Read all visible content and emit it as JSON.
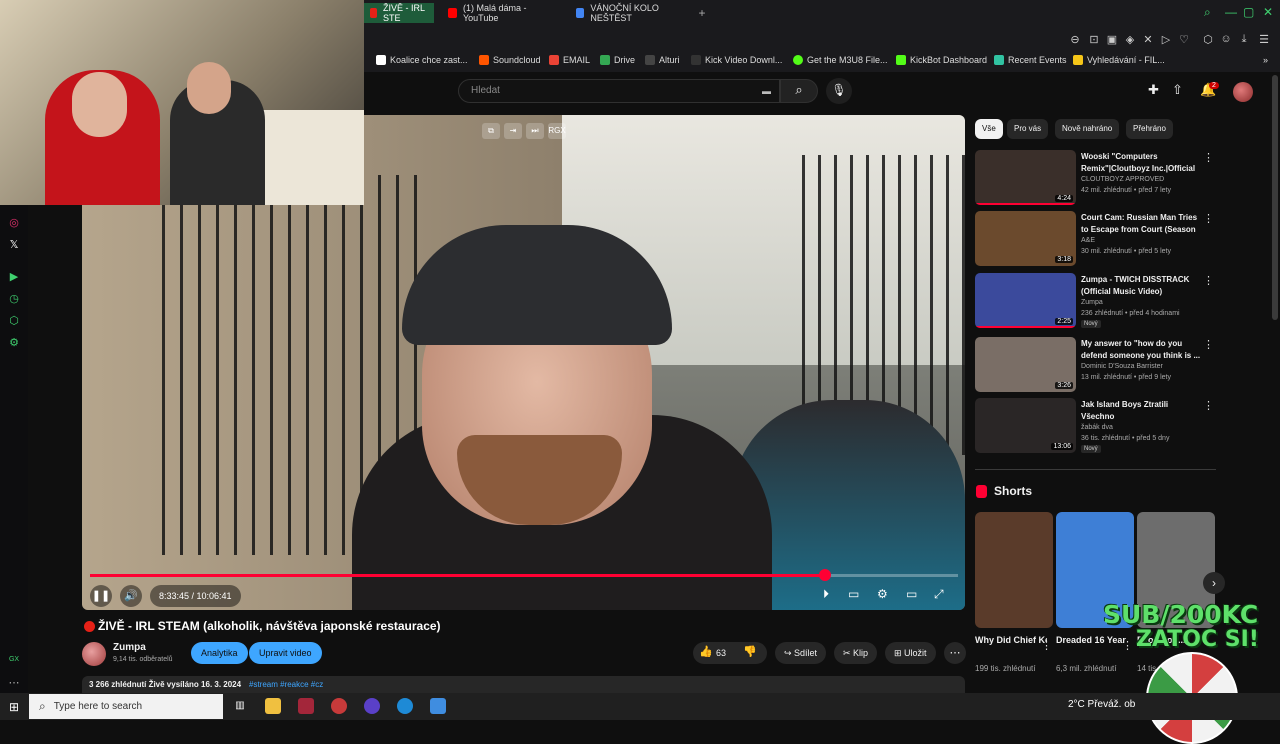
{
  "browser": {
    "tabs": [
      {
        "label": "ŽIVĚ - IRL STE",
        "color": "#e62117"
      },
      {
        "label": "(1) Malá dáma - YouTube",
        "color": "#ff0000"
      },
      {
        "label": "VÁNOČNÍ KOLO NEŠTĚST",
        "color": "#4285f4"
      }
    ],
    "new_tab": "+",
    "bookmarks": [
      {
        "label": "Koalice chce zast...",
        "color": "#ffffff"
      },
      {
        "label": "Soundcloud",
        "color": "#ff5500"
      },
      {
        "label": "EMAIL",
        "color": "#ea4335"
      },
      {
        "label": "Drive",
        "color": "#34a853"
      },
      {
        "label": "Alturi",
        "color": "#444444"
      },
      {
        "label": "Kick Video Downl...",
        "color": "#53fc18"
      },
      {
        "label": "Get the M3U8 File...",
        "color": "#53fc18"
      },
      {
        "label": "KickBot Dashboard",
        "color": "#53fc18"
      },
      {
        "label": "Recent Events",
        "color": "#31c3a2"
      },
      {
        "label": "Vyhledávání - FIL...",
        "color": "#f5c518"
      }
    ]
  },
  "youtube": {
    "search_placeholder": "Hledat",
    "notification_count": "2",
    "video": {
      "title": "ŽIVĚ - IRL STEAM (alkoholik, návštěva japonské restaurace)",
      "time_current": "8:33:45",
      "time_total": "10:06:41",
      "time_display": "8:33:45 / 10:06:41",
      "progress": 0.847,
      "channel_name": "Zumpa",
      "channel_subs": "9,14 tis. odběratelů",
      "btn_analytics": "Analytika",
      "btn_edit": "Upravit video",
      "likes": "63",
      "share": "Sdílet",
      "clip": "Klip",
      "save": "Uložit",
      "views_line": "3 266 zhlédnutí  Živě vysíláno 16. 3. 2024",
      "tags": "#stream #reakce #cz"
    },
    "chips": [
      "Vše",
      "Pro vás",
      "Nově nahráno",
      "Přehráno"
    ],
    "recommendations": [
      {
        "title": "Wooski \"Computers Remix\"|Cloutboyz Inc.|Official ...",
        "channel": "CLOUTBOYZ APPROVED",
        "meta": "42 mil. zhlédnutí • před 7 lety",
        "duration": "4:24",
        "watched": 1.0,
        "thumb": "#3a2f2a",
        "new": ""
      },
      {
        "title": "Court Cam: Russian Man Tries to Escape from Court (Season ...",
        "channel": "A&E",
        "meta": "30 mil. zhlédnutí • před 5 lety",
        "duration": "3:18",
        "watched": 0,
        "thumb": "#6b4a2d",
        "new": ""
      },
      {
        "title": "Zumpa - TWICH DISSTRACK (Official Music Video)",
        "channel": "Zumpa",
        "meta": "236 zhlédnutí • před 4 hodinami",
        "duration": "2:25",
        "watched": 1.0,
        "thumb": "#3b4a9c",
        "new": "Nový"
      },
      {
        "title": "My answer to \"how do you defend someone you think is ...",
        "channel": "Dominic D'Souza Barrister",
        "meta": "13 mil. zhlédnutí • před 9 lety",
        "duration": "3:26",
        "watched": 0,
        "thumb": "#7a6e66",
        "new": ""
      },
      {
        "title": "Jak Island Boys Ztratili Všechno",
        "channel": "žabák dva",
        "meta": "36 tis. zhlédnutí • před 5 dny",
        "duration": "13:06",
        "watched": 0,
        "thumb": "#2a2626",
        "new": "Nový"
      }
    ],
    "shorts_heading": "Shorts",
    "shorts": [
      {
        "title": "Why Did Chief Keef ...",
        "views": "199 tis. zhlédnutí",
        "thumb": "#5a3b2a"
      },
      {
        "title": "Dreaded 16 Year Old ...",
        "views": "6,3 mil. zhlédnutí",
        "thumb": "#3e7fd6"
      },
      {
        "title": "Evolution...",
        "views": "14 tis. zhlédnutí",
        "thumb": "#6d6d6d"
      }
    ]
  },
  "overlay": {
    "sub_text": "SUB/200KC",
    "zatoc_text": "ZATOC SI!"
  },
  "taskbar": {
    "search_placeholder": "Type here to search",
    "weather": "2°C  Převáž. ob"
  }
}
